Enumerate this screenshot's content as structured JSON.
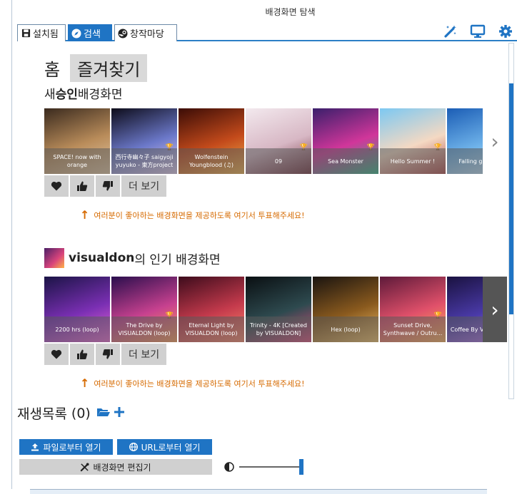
{
  "window": {
    "title": "배경화면 탐색"
  },
  "tabs": [
    {
      "label": "설치됨",
      "icon": "save-icon",
      "active": false
    },
    {
      "label": "검색",
      "icon": "compass-icon",
      "active": true
    },
    {
      "label": "창작마당",
      "icon": "steam-icon",
      "active": false
    }
  ],
  "toolbar": {
    "icons": [
      "wand-icon",
      "monitor-icon",
      "gear-icon"
    ]
  },
  "nav": {
    "home": "홈",
    "favorites": "즐겨찾기"
  },
  "section1": {
    "title_prefix": "새 ",
    "title_bold": "승인",
    "title_suffix": " 배경화면",
    "items": [
      {
        "caption": "SPACE! now with orange",
        "trophy": false,
        "colors": [
          "#3a2a1e",
          "#b98c5a",
          "#e5c9a6"
        ]
      },
      {
        "caption": "西行寺幽々子 saigyoji yuyuko - 東方project",
        "trophy": true,
        "colors": [
          "#0d0c1a",
          "#6b78c9",
          "#e6d0f2"
        ]
      },
      {
        "caption": "Wolfenstein Youngblood (♫)",
        "trophy": false,
        "colors": [
          "#3b0c06",
          "#c34a1b",
          "#f2b34d"
        ]
      },
      {
        "caption": "09",
        "trophy": true,
        "colors": [
          "#f3e9ee",
          "#d7b7c4",
          "#6e2d3a"
        ]
      },
      {
        "caption": "Sea Monster",
        "trophy": true,
        "colors": [
          "#3a1f6b",
          "#d1369a",
          "#2fb889"
        ]
      },
      {
        "caption": "Hello Summer !",
        "trophy": true,
        "colors": [
          "#7cc8f2",
          "#f4d9c3",
          "#b04a4a"
        ]
      },
      {
        "caption": "Falling girl 少女",
        "trophy": false,
        "colors": [
          "#1b5db5",
          "#6fb3ea",
          "#d6eefb"
        ]
      }
    ],
    "more_label": "더 보기",
    "hint": "여러분이 좋아하는 배경화면을 제공하도록 여기서 투표해주세요!"
  },
  "section2": {
    "title_bold": "visualdon",
    "title_suffix": "의 인기 배경화면",
    "items": [
      {
        "caption": "2200 hrs (loop)",
        "trophy": false,
        "colors": [
          "#1b1446",
          "#7a2fb3",
          "#f06ad6"
        ]
      },
      {
        "caption": "The Drive by VISUALDON (loop)",
        "trophy": true,
        "colors": [
          "#2a0e4d",
          "#c7418f",
          "#ff9f5a"
        ]
      },
      {
        "caption": "Eternal Light by VISUALDON (loop)",
        "trophy": false,
        "colors": [
          "#3d0c1c",
          "#c43a4c",
          "#ff8a6d"
        ]
      },
      {
        "caption": "Trinity - 4K [Created by VISUALDON]",
        "trophy": false,
        "colors": [
          "#0a0f12",
          "#2e4a4f",
          "#e04c7c"
        ]
      },
      {
        "caption": "Hex (loop)",
        "trophy": false,
        "colors": [
          "#1a1410",
          "#8a5a1e",
          "#f5c36a"
        ]
      },
      {
        "caption": "Sunset Drive, Synthwave / Outru...",
        "trophy": true,
        "colors": [
          "#5e1a3a",
          "#e0506a",
          "#ffb35c"
        ]
      },
      {
        "caption": "Coffee By VISUALDO",
        "trophy": false,
        "colors": [
          "#1a1240",
          "#4a3aa8",
          "#c17bf0"
        ]
      }
    ],
    "more_label": "더 보기",
    "hint": "여러분이 좋아하는 배경화면을 제공하도록 여기서 투표해주세요!"
  },
  "playlist": {
    "label": "재생목록",
    "count": "(0)"
  },
  "bottom": {
    "open_file": "파일로부터 열기",
    "open_url": "URL로부터 열기",
    "editor": "배경화면 편집기",
    "slider_value": 1.0
  },
  "colors": {
    "accent": "#1f74c4",
    "hint": "#d66a00"
  }
}
